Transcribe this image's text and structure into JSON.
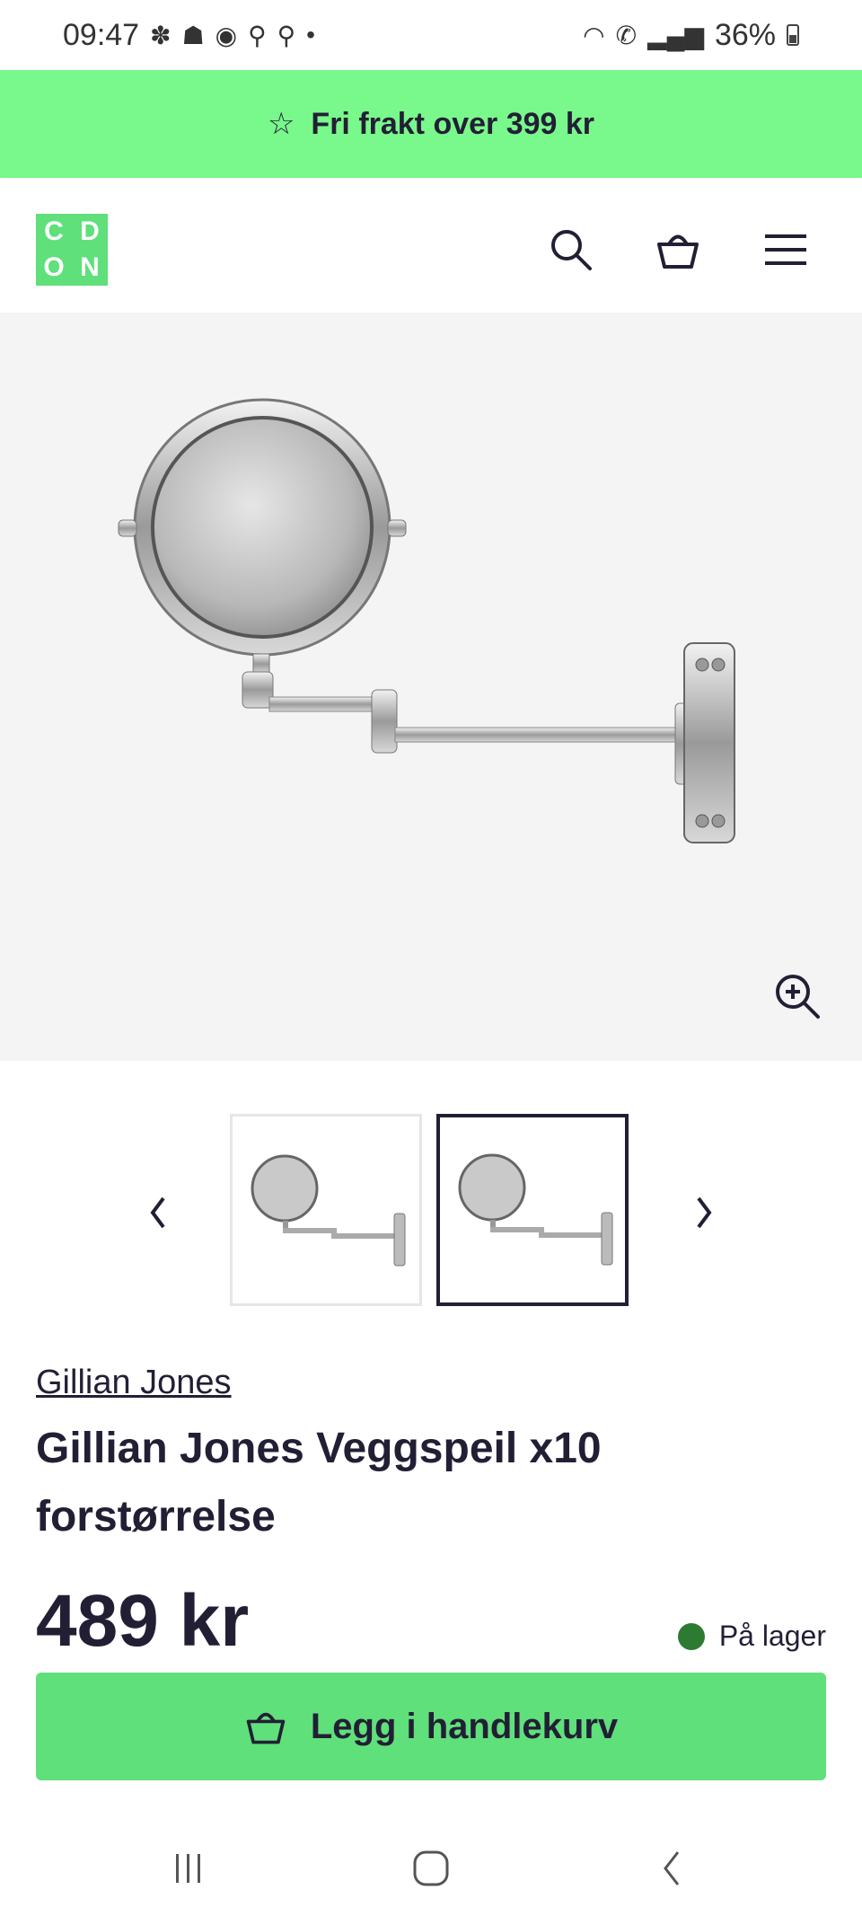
{
  "status_bar": {
    "time": "09:47",
    "battery": "36%",
    "left_icons": [
      "fan-icon",
      "snapchat-icon",
      "spotify-icon",
      "walk-icon",
      "walk-icon",
      "dot-icon"
    ],
    "right_icons": [
      "wifi-icon",
      "wifi-call-icon",
      "signal-icon"
    ]
  },
  "promo": {
    "text": "Fri frakt over 399 kr",
    "icon": "star-icon"
  },
  "header": {
    "logo_letters": [
      "C",
      "D",
      "O",
      "N"
    ],
    "icons": [
      "search-icon",
      "basket-icon",
      "menu-icon"
    ]
  },
  "gallery": {
    "image": "wall-mirror-image",
    "zoom_icon": "zoom-in-icon",
    "thumbnails": [
      {
        "image": "wall-mirror-thumbnail",
        "selected": false
      },
      {
        "image": "wall-mirror-thumbnail",
        "selected": true
      }
    ],
    "prev_icon": "chevron-left-icon",
    "next_icon": "chevron-right-icon"
  },
  "product": {
    "brand": "Gillian Jones",
    "title": "Gillian Jones Veggspeil x10 forstørrelse",
    "price": "489 kr",
    "stock": "På lager",
    "add_to_cart": "Legg i handlekurv"
  },
  "colors": {
    "accent_green": "#79f88c",
    "button_green": "#5fe07a",
    "text_dark": "#221f35",
    "stock_green": "#2d7a32"
  },
  "nav_bar": {
    "icons": [
      "recent-apps-icon",
      "home-icon",
      "back-icon"
    ]
  }
}
